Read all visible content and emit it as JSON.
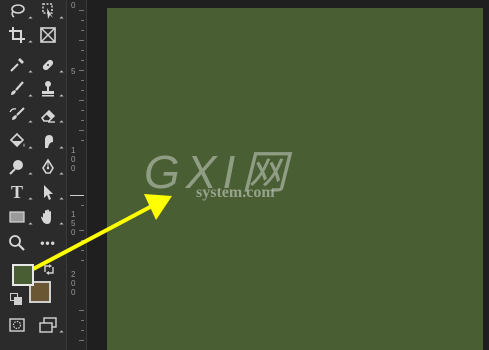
{
  "toolbar": {
    "tools": [
      {
        "id": "lasso",
        "icon": "lasso-icon"
      },
      {
        "id": "quick-select",
        "icon": "quick-select-icon"
      },
      {
        "id": "crop",
        "icon": "crop-icon"
      },
      {
        "id": "frame",
        "icon": "frame-icon"
      },
      {
        "id": "eyedropper",
        "icon": "eyedropper-icon"
      },
      {
        "id": "healing",
        "icon": "healing-brush-icon"
      },
      {
        "id": "brush",
        "icon": "brush-icon"
      },
      {
        "id": "stamp",
        "icon": "clone-stamp-icon"
      },
      {
        "id": "history-brush",
        "icon": "history-brush-icon"
      },
      {
        "id": "eraser",
        "icon": "eraser-icon"
      },
      {
        "id": "bucket",
        "icon": "paint-bucket-icon"
      },
      {
        "id": "smudge",
        "icon": "smudge-icon"
      },
      {
        "id": "dodge",
        "icon": "dodge-icon"
      },
      {
        "id": "pen",
        "icon": "pen-icon"
      },
      {
        "id": "type",
        "icon": "type-icon",
        "label": "T"
      },
      {
        "id": "path-select",
        "icon": "path-selection-icon"
      },
      {
        "id": "rectangle",
        "icon": "rectangle-icon"
      },
      {
        "id": "hand",
        "icon": "hand-icon"
      },
      {
        "id": "zoom",
        "icon": "zoom-icon"
      },
      {
        "id": "more",
        "icon": "more-icon",
        "label": "•••"
      }
    ],
    "foreground_color": "#4a5e33",
    "background_color": "#6b5634"
  },
  "ruler": {
    "labels": [
      "0",
      "5",
      "1 0 0",
      "1 5 0",
      "2 0 0"
    ]
  },
  "canvas": {
    "fill_color": "#4a5e33"
  },
  "watermark": {
    "logo": "GXI网",
    "site": "system.com"
  },
  "annotation": {
    "arrow_color": "#ffff00"
  }
}
